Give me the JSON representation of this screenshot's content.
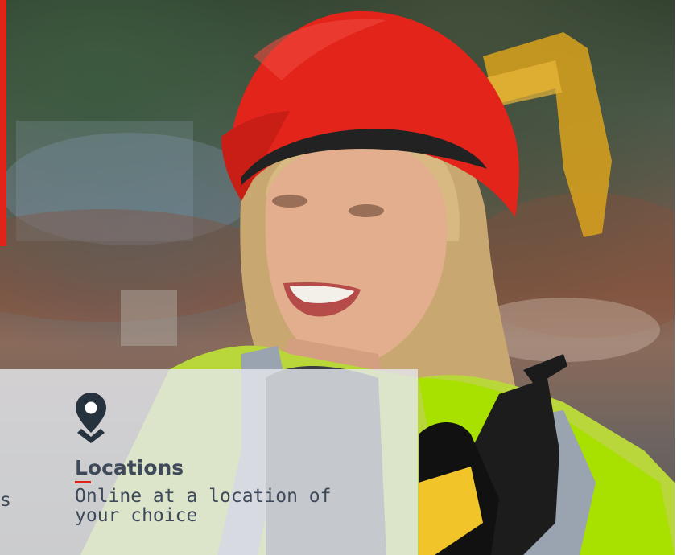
{
  "hero": {
    "image_alt": "",
    "accent_color": "#e2231a"
  },
  "info_card": {
    "left_fragment": "s",
    "location": {
      "icon": "map-pin-icon",
      "title": "Locations",
      "description": "Online at a location of your choice"
    }
  }
}
